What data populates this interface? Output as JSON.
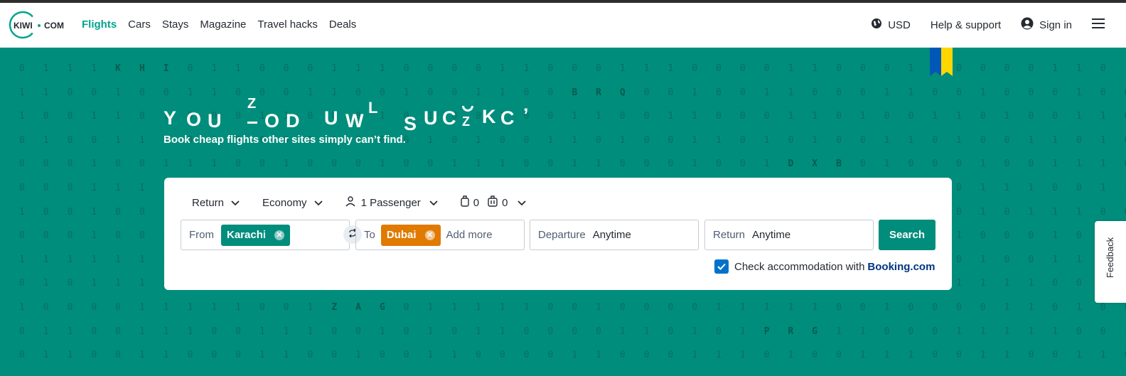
{
  "header": {
    "logo_text": "KIWI • COM",
    "nav": [
      {
        "label": "Flights",
        "active": true
      },
      {
        "label": "Cars",
        "active": false
      },
      {
        "label": "Stays",
        "active": false
      },
      {
        "label": "Magazine",
        "active": false
      },
      {
        "label": "Travel hacks",
        "active": false
      },
      {
        "label": "Deals",
        "active": false
      }
    ],
    "currency": "USD",
    "help": "Help & support",
    "signin": "Sign in"
  },
  "hero": {
    "headline_letters": [
      "Y",
      "O",
      "U",
      "Z",
      "O",
      "D",
      "U",
      "W",
      "L",
      "S",
      "U",
      "C",
      "Z",
      "K",
      "C",
      "’"
    ],
    "subline": "Book cheap flights other sites simply can’t find.",
    "digit_rows": [
      "0 1 1 1 K H I 0 1 1 0 0 0 1 1 1 0 0 0 0 1 1 0 0 0 1 1 1 0 0 0 0 1 1 0 0 0 1 1 0 0 0 0 1 1 0",
      "1 1 0 0 1 0 0 1 1 0 0 0 1 1 0 0 1 0 0 1 1 0 0 B R Q 0 0 1 0 0 1 1 0 0 0 1 1 0 0 1 0 0 0 1 0 0",
      "1 0 0 1 1 0 1 0 0 0 1 1 0 0 0 1 0 1 0 0 1 0 0 1 1 0 0 1 1 0 0 0 1 1 0 1 0 0 1 1 0 1 0 0 1 1 0",
      "0 1 0 0 1 1 1 0 1 0 0 0 1 1 0 0 0 1 0 1 0 0 1 1 0 1 0 0 1 1 0 1 0 1 0 0 1 1 0 1 0 0 1 1 0 1 0",
      "0 0 0 1 0 0 1 1 1 0 0 1 0 0 0 1 0 0 1 1 1 0 0 1 1 0 0 0 1 0 0 1 D X B 0 1 0 0 0 1 0 0 1 1 1 0",
      "0 0 0 1 1 1 1 0 0 0 1 0 1 0 0 1 1 0 0 0 1 1 0 0 1 0 0 0 1 0 0 1 1 1 0 0 0 1 1 0 1 1 1 0 0 1 1",
      "1 0 0 1 0 0 1 0 0 0 1 1 0 1 0 0 1 0 0 1 1 0 0 0 1 0 0 1 1 0 0 0 1 1 0 0 0 1 1 0 1 0 1 1 1 0 0",
      "0 0 0 1 0 0 0 1 1 0 0 1 0 0 1 1 0 0 1 1 0 0 1 0 0 0 1 1 0 0 1 0 0 0 1 1 0 0 1 1 0 0 0 1 0 1 1",
      "1 1 1 1 1 1 0 1 0 0 1 1 0 0 1 0 0 1 1 0 0 0 1 1 0 0 1 0 0 1 1 0 1 1 1 0 0 1 1 0 1 0 0 1 1 0 1",
      "0 1 0 1 1 1 0 0 0 1 1 0 0 0 1 1 0 0 1 0 0 0 1 1 0 0 0 1 1 0 0 1 0 0 0 1 1 0 0 1 1 1 1 0 0 0 1",
      "1 0 0 0 0 1 1 1 1 1 0 0 1 Z A G 0 1 1 1 1 1 0 0 1 0 0 0 0 1 1 1 1 1 0 0 1 0 0 0 0 1 1 0 1 0 0",
      "0 1 1 0 0 1 1 1 0 0 1 1 1 0 0 1 0 1 0 1 1 0 0 0 0 1 1 0 1 0 1 P R G 1 1 0 0 0 1 1 1 1 1 0 0 1",
      "0 1 1 0 0 1 1 0 0 0 1 1 0 0 1 0 0 1 1 0 0 0 0 1 1 0 0 0 1 1 1 0 1 0 0 1 1 1 0 0 1 1 0 0 1 1 0"
    ]
  },
  "search": {
    "trip_type": "Return",
    "cabin": "Economy",
    "passengers": "1 Passenger",
    "cabin_bags": "0",
    "checked_bags": "0",
    "from_label": "From",
    "from_value": "Karachi",
    "to_label": "To",
    "to_value": "Dubai",
    "add_more": "Add more",
    "departure_label": "Departure",
    "departure_value": "Anytime",
    "return_label": "Return",
    "return_value": "Anytime",
    "search_button": "Search",
    "accommodation_text": "Check accommodation with",
    "accommodation_brand": "Booking.com",
    "accommodation_checked": true
  },
  "feedback": "Feedback",
  "colors": {
    "brand": "#008d7c",
    "active_nav": "#00a58e",
    "from_chip": "#008d7c",
    "to_chip": "#e07a00",
    "checkbox": "#0172cb",
    "booking_brand": "#003580"
  }
}
